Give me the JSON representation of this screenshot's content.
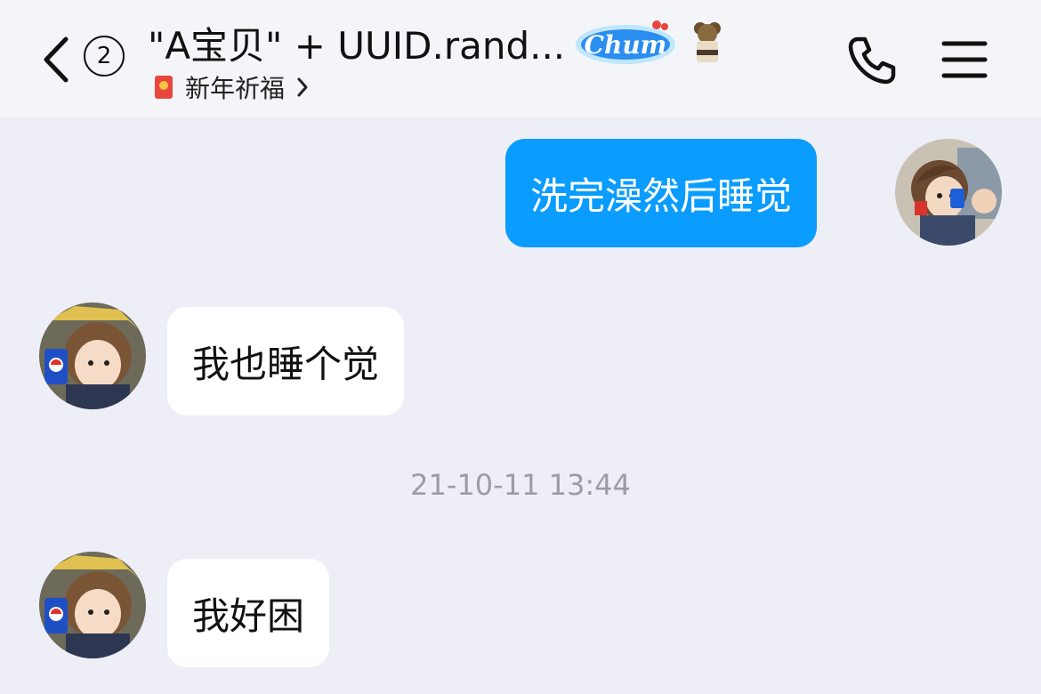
{
  "header": {
    "unread_count": "2",
    "title": "\"A宝贝\" + UUID.rand...",
    "subtitle": "新年祈福",
    "badge_icon": "chum-badge-icon",
    "accent": "#0a9cff"
  },
  "messages": [
    {
      "sender": "me",
      "text": "洗完澡然后睡觉"
    },
    {
      "sender": "them",
      "text": "我也睡个觉"
    },
    {
      "sender": "them",
      "text": "我好困"
    }
  ],
  "timestamp": "21-10-11 13:44",
  "colors": {
    "background": "#edeef6",
    "header": "#f4f5f9",
    "outgoing_bubble": "#0a9cff",
    "incoming_bubble": "#ffffff",
    "timestamp_text": "#9b9ca6"
  }
}
